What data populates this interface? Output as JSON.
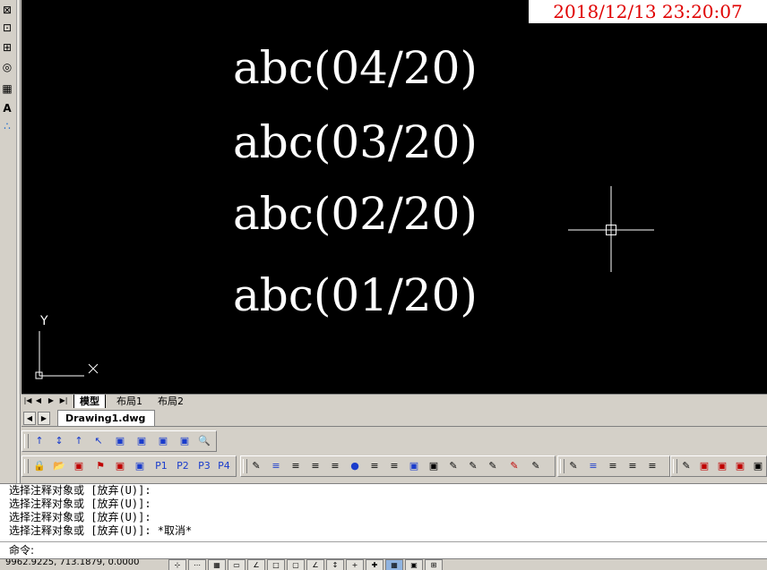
{
  "timestamp": "2018/12/13 23:20:07",
  "canvas": {
    "texts": [
      "abc(04/20)",
      "abc(03/20)",
      "abc(02/20)",
      "abc(01/20)"
    ],
    "ucs": {
      "x_label": "X",
      "y_label": "Y"
    }
  },
  "layout_tabs": {
    "nav": [
      "|◀",
      "◀",
      "▶",
      "▶|"
    ],
    "tabs": [
      "模型",
      "布局1",
      "布局2"
    ]
  },
  "doc_tabs": {
    "prev": "◀",
    "next": "▶",
    "active": "Drawing1.dwg"
  },
  "toolbars": {
    "views": [
      "↑",
      "↕",
      "↑",
      "↖",
      "▣",
      "▣",
      "▣",
      "▣",
      "🔍"
    ],
    "layers": [
      "🔒",
      "📂",
      "▣",
      "⚑",
      "▣",
      "▣",
      "P1",
      "P2",
      "P3",
      "P4"
    ],
    "props": [
      "✎",
      "≡",
      "≡",
      "≡",
      "≡",
      "●",
      "≡",
      "≡",
      "▣",
      "▣",
      "✎",
      "✎",
      "✎",
      "✎",
      "✎"
    ],
    "props2": [
      "✎",
      "≡",
      "≡",
      "≡",
      "≡"
    ],
    "extra": [
      "✎",
      "▣",
      "▣",
      "▣",
      "▣"
    ]
  },
  "command_history": [
    "选择注释对象或 [放弃(U)]:",
    "选择注释对象或 [放弃(U)]:",
    "选择注释对象或 [放弃(U)]:",
    "选择注释对象或 [放弃(U)]: *取消*"
  ],
  "command_prompt": "命令:",
  "status": {
    "coords": "9962.9225, 713.1879, 0.0000"
  },
  "colors": {
    "canvas_bg": "#000000",
    "drawing_text": "#ffffff",
    "timestamp_fg": "#e00000"
  }
}
